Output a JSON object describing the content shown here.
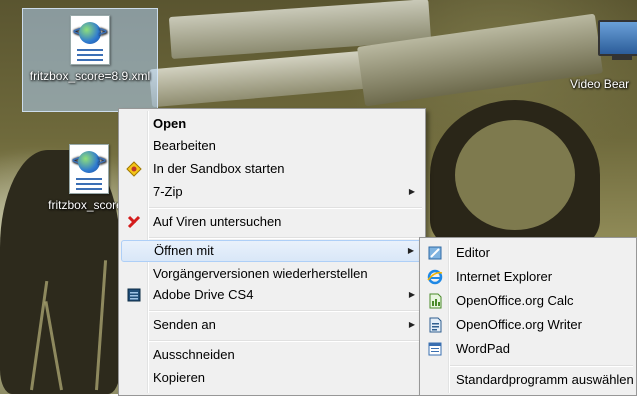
{
  "desktop": {
    "icons": [
      {
        "label": "fritzbox_score=8.9.xml",
        "selected": true
      },
      {
        "label": "fritzbox_score="
      }
    ],
    "video_label": "Video Bear"
  },
  "context_menu": {
    "items": [
      {
        "label": "Open",
        "bold": true
      },
      {
        "label": "Bearbeiten"
      },
      {
        "label": "In der Sandbox starten",
        "icon": "sandboxie-icon"
      },
      {
        "label": "7-Zip",
        "submenu": true
      },
      {
        "label": "Auf Viren untersuchen",
        "icon": "antivirus-icon"
      },
      {
        "label": "Öffnen mit",
        "submenu": true,
        "highlighted": true
      },
      {
        "label": "Vorgängerversionen wiederherstellen"
      },
      {
        "label": "Adobe Drive CS4",
        "submenu": true,
        "icon": "adobe-drive-icon"
      },
      {
        "label": "Senden an",
        "submenu": true
      },
      {
        "label": "Ausschneiden"
      },
      {
        "label": "Kopieren"
      }
    ],
    "arrow_glyph": "▶"
  },
  "open_with_menu": {
    "items": [
      {
        "label": "Editor",
        "icon": "notepad-icon"
      },
      {
        "label": "Internet Explorer",
        "icon": "internet-explorer-icon"
      },
      {
        "label": "OpenOffice.org Calc",
        "icon": "openoffice-calc-icon"
      },
      {
        "label": "OpenOffice.org Writer",
        "icon": "openoffice-writer-icon"
      },
      {
        "label": "WordPad",
        "icon": "wordpad-icon"
      },
      {
        "label": "Standardprogramm auswählen"
      }
    ]
  },
  "colors": {
    "menu_bg": "#f0f0f0",
    "highlight_border": "#aecff7",
    "selection_bg": "#b0d2f5"
  }
}
